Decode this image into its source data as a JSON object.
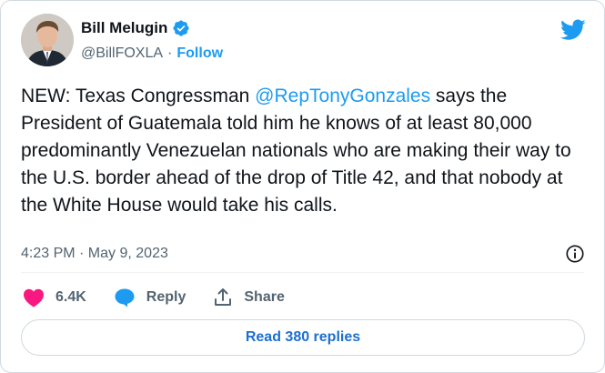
{
  "author": {
    "name": "Bill Melugin",
    "handle": "@BillFOXLA",
    "separator": "·",
    "follow_label": "Follow"
  },
  "tweet": {
    "text_before": "NEW: Texas Congressman ",
    "mention": "@RepTonyGonzales",
    "text_after": " says the President of Guatemala told him he knows of at least 80,000 predominantly Venezuelan nationals who are making their way to the U.S. border ahead of the drop of Title 42, and that nobody at the White House would take his calls."
  },
  "meta": {
    "timestamp": "4:23 PM · May 9, 2023"
  },
  "actions": {
    "likes_count": "6.4K",
    "reply_label": "Reply",
    "share_label": "Share"
  },
  "replies_button": {
    "label": "Read 380 replies"
  },
  "colors": {
    "accent": "#1d9bf0",
    "like": "#f91880",
    "text": "#0f1419",
    "secondary": "#536471",
    "border": "#cfd9de"
  }
}
